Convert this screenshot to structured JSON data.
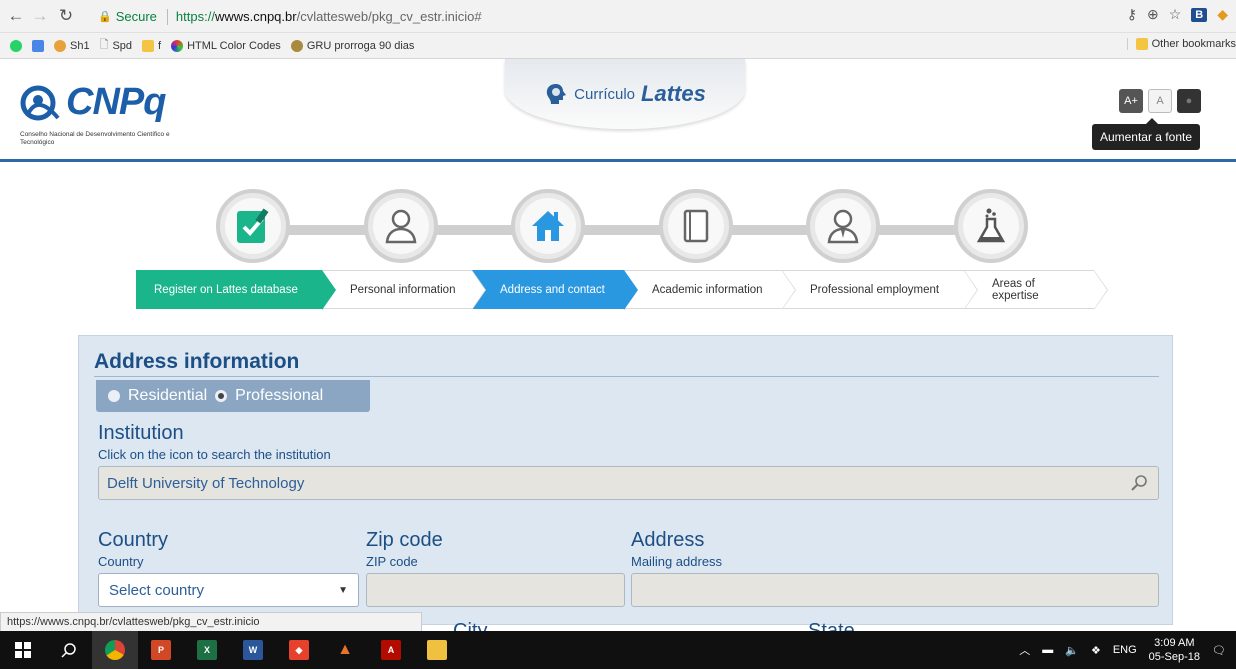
{
  "browser": {
    "secure_label": "Secure",
    "url_proto": "https://",
    "url_host": "wwws.cnpq.br",
    "url_path": "/cvlattesweb/pkg_cv_estr.inicio#",
    "ext_label": "B"
  },
  "bookmarks": {
    "items": [
      "Sh1",
      "Spd",
      "f",
      "HTML Color Codes",
      "GRU prorroga 90 dias"
    ],
    "other": "Other bookmarks"
  },
  "header": {
    "logo_text": "CNPq",
    "logo_sub": "Conselho Nacional de Desenvolvimento Científico e Tecnológico",
    "tab_prefix": "Currículo",
    "tab_title": "Lattes",
    "font_plus": "A+",
    "font_normal": "A",
    "tooltip": "Aumentar a fonte"
  },
  "steps": [
    {
      "label": "Register on Lattes database",
      "state": "done"
    },
    {
      "label": "Personal information",
      "state": "todo"
    },
    {
      "label": "Address and contact",
      "state": "active"
    },
    {
      "label": "Academic information",
      "state": "todo"
    },
    {
      "label": "Professional employment",
      "state": "todo"
    },
    {
      "label": "Areas of expertise",
      "state": "todo"
    }
  ],
  "form": {
    "title": "Address information",
    "radio_residential": "Residential",
    "radio_professional": "Professional",
    "selected_type": "Professional",
    "institution_label": "Institution",
    "institution_hint": "Click on the icon to search the institution",
    "institution_value": "Delft University of Technology",
    "country_label": "Country",
    "country_sub": "Country",
    "country_value": "Select country",
    "zip_label": "Zip code",
    "zip_sub": "ZIP code",
    "zip_value": "",
    "address_label": "Address",
    "address_sub": "Mailing address",
    "address_value": "",
    "city_label": "City",
    "state_label": "State"
  },
  "status_bar_url": "https://wwws.cnpq.br/cvlattesweb/pkg_cv_estr.inicio",
  "taskbar": {
    "lang": "ENG",
    "time": "3:09 AM",
    "date": "05-Sep-18"
  }
}
